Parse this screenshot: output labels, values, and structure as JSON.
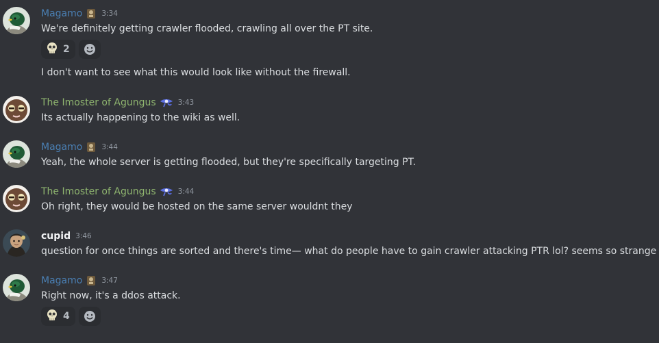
{
  "colors": {
    "background": "#313338",
    "magamo_name": "#4a7fb3",
    "imoster_name": "#8fb56f",
    "cupid_name": "#f2f3f5",
    "timestamp": "#949ba4",
    "text": "#dbdee1"
  },
  "messages": [
    {
      "author": "Magamo",
      "badge_icon": "guild-tag-icon",
      "time": "3:34",
      "lines": [
        "We're definitely getting crawler flooded, crawling all over the PT site."
      ],
      "reactions": [
        {
          "emoji": "skull-face-emoji-icon",
          "count": "2"
        }
      ],
      "followup": "I don't want to see what this would look like without the firewall."
    },
    {
      "author": "The Imoster of Agungus",
      "badge_icon": "eye-of-horus-icon",
      "time": "3:43",
      "lines": [
        "Its actually happening to the wiki as well."
      ]
    },
    {
      "author": "Magamo",
      "badge_icon": "guild-tag-icon",
      "time": "3:44",
      "lines": [
        "Yeah, the whole server is getting flooded, but they're specifically targeting PT."
      ]
    },
    {
      "author": "The Imoster of Agungus",
      "badge_icon": "eye-of-horus-icon",
      "time": "3:44",
      "lines": [
        "Oh right, they would be hosted on the same server wouldnt they"
      ]
    },
    {
      "author": "cupid",
      "time": "3:46",
      "lines": [
        "question for once things are sorted and there's time— what do people have to gain crawler attacking PTR lol? seems so strange"
      ]
    },
    {
      "author": "Magamo",
      "badge_icon": "guild-tag-icon",
      "time": "3:47",
      "lines": [
        "Right now, it's a ddos attack."
      ],
      "reactions": [
        {
          "emoji": "skull-face-emoji-icon",
          "count": "4"
        }
      ]
    }
  ]
}
